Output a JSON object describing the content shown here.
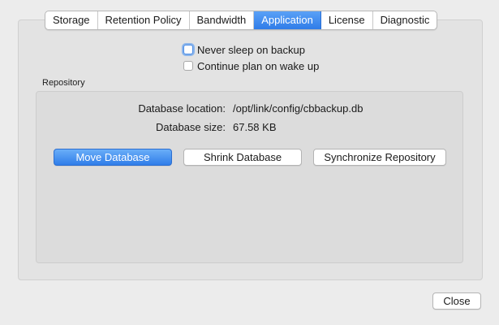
{
  "tabs": [
    {
      "label": "Storage"
    },
    {
      "label": "Retention Policy"
    },
    {
      "label": "Bandwidth"
    },
    {
      "label": "Application",
      "active": true
    },
    {
      "label": "License"
    },
    {
      "label": "Diagnostic"
    }
  ],
  "options": {
    "never_sleep": {
      "label": "Never sleep on backup",
      "checked": false
    },
    "continue_plan": {
      "label": "Continue plan on wake up",
      "checked": false
    }
  },
  "repository": {
    "title": "Repository",
    "location_label": "Database location:",
    "location_value": "/opt/link/config/cbbackup.db",
    "size_label": "Database size:",
    "size_value": "67.58 KB",
    "move_button": "Move Database",
    "shrink_button": "Shrink Database",
    "sync_button": "Synchronize Repository"
  },
  "footer": {
    "close_button": "Close"
  },
  "colors": {
    "accent": "#2f7de9",
    "window_bg": "#ececec"
  }
}
